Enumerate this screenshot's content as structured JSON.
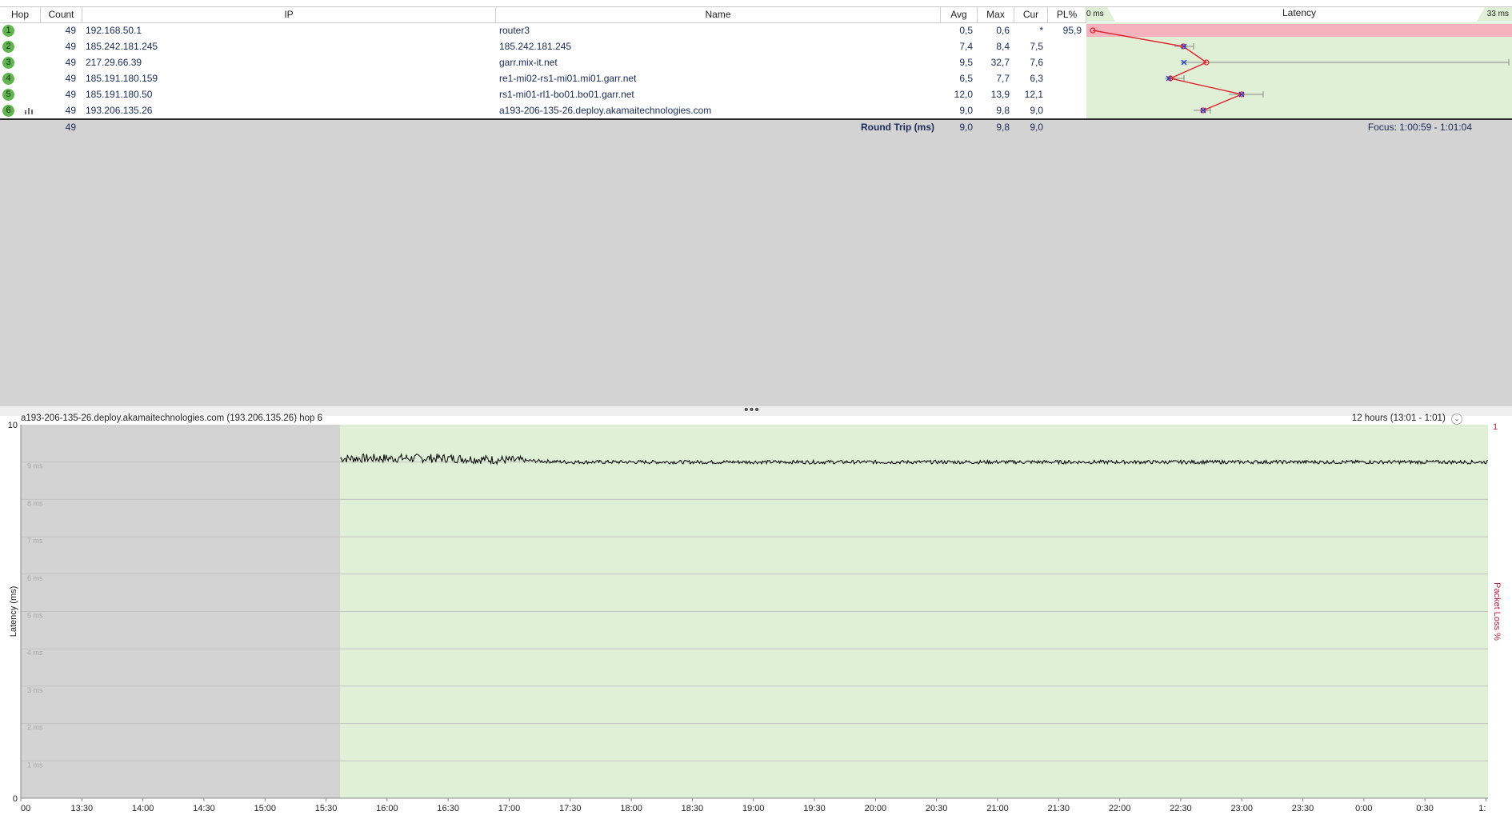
{
  "columns": {
    "hop": "Hop",
    "count": "Count",
    "ip": "IP",
    "name": "Name",
    "avg": "Avg",
    "max": "Max",
    "cur": "Cur",
    "pl": "PL%",
    "latency": "Latency"
  },
  "latency_scale": {
    "min_label": "0 ms",
    "max_label": "33 ms"
  },
  "hops": [
    {
      "hop": "1",
      "count": "49",
      "ip": "192.168.50.1",
      "name": "router3",
      "avg": "0,5",
      "max": "0,6",
      "cur": "*",
      "pl": "95,9"
    },
    {
      "hop": "2",
      "count": "49",
      "ip": "185.242.181.245",
      "name": "185.242.181.245",
      "avg": "7,4",
      "max": "8,4",
      "cur": "7,5",
      "pl": ""
    },
    {
      "hop": "3",
      "count": "49",
      "ip": "217.29.66.39",
      "name": "garr.mix-it.net",
      "avg": "9,5",
      "max": "32,7",
      "cur": "7,6",
      "pl": ""
    },
    {
      "hop": "4",
      "count": "49",
      "ip": "185.191.180.159",
      "name": "re1-mi02-rs1-mi01.mi01.garr.net",
      "avg": "6,5",
      "max": "7,7",
      "cur": "6,3",
      "pl": ""
    },
    {
      "hop": "5",
      "count": "49",
      "ip": "185.191.180.50",
      "name": "rs1-mi01-rl1-bo01.bo01.garr.net",
      "avg": "12,0",
      "max": "13,9",
      "cur": "12,1",
      "pl": ""
    },
    {
      "hop": "6",
      "count": "49",
      "ip": "193.206.135.26",
      "name": "a193-206-135-26.deploy.akamaitechnologies.com",
      "avg": "9,0",
      "max": "9,8",
      "cur": "9,0",
      "pl": ""
    }
  ],
  "footer": {
    "count": "49",
    "label": "Round Trip (ms)",
    "avg": "9,0",
    "max": "9,8",
    "cur": "9,0",
    "focus": "Focus: 1:00:59 - 1:01:04"
  },
  "graph": {
    "title": "a193-206-135-26.deploy.akamaitechnologies.com (193.206.135.26) hop 6",
    "range": "12 hours (13:01 - 1:01)",
    "ylabel": "Latency (ms)",
    "y2label": "Packet Loss %",
    "y2_top": "1",
    "y_ticks": [
      "0",
      "1 ms",
      "2 ms",
      "3 ms",
      "4 ms",
      "5 ms",
      "6 ms",
      "7 ms",
      "8 ms",
      "9 ms",
      "10"
    ],
    "x_ticks": [
      "00",
      "13:30",
      "14:00",
      "14:30",
      "15:00",
      "15:30",
      "16:00",
      "16:30",
      "17:00",
      "17:30",
      "18:00",
      "18:30",
      "19:00",
      "19:30",
      "20:00",
      "20:30",
      "21:00",
      "21:30",
      "22:00",
      "22:30",
      "23:00",
      "23:30",
      "0:00",
      "0:30",
      "1:"
    ],
    "colors": {
      "active_bg": "#dff0d6",
      "inactive_bg": "#d3d3d3",
      "line": "#000000",
      "loss_label": "#c0203a"
    }
  },
  "chart_data": {
    "type": "line",
    "title": "a193-206-135-26.deploy.akamaitechnologies.com (193.206.135.26) hop 6",
    "ylabel": "Latency (ms)",
    "y2label": "Packet Loss %",
    "ylim": [
      0,
      10
    ],
    "xlim": [
      "13:00",
      "1:01"
    ],
    "data_start": "15:37",
    "x": [
      "15:37",
      "16:00",
      "16:30",
      "17:00",
      "17:30",
      "18:00",
      "18:30",
      "19:00",
      "19:30",
      "20:00",
      "20:30",
      "21:00",
      "21:30",
      "22:00",
      "22:30",
      "23:00",
      "23:30",
      "0:00",
      "0:30",
      "1:01"
    ],
    "values": [
      9.1,
      9.1,
      9.1,
      9.05,
      9.0,
      9.0,
      9.0,
      9.0,
      9.0,
      9.0,
      9.0,
      9.0,
      9.0,
      9.0,
      9.0,
      9.0,
      9.0,
      9.0,
      9.0,
      9.0
    ],
    "legend": "none",
    "grid": true
  }
}
